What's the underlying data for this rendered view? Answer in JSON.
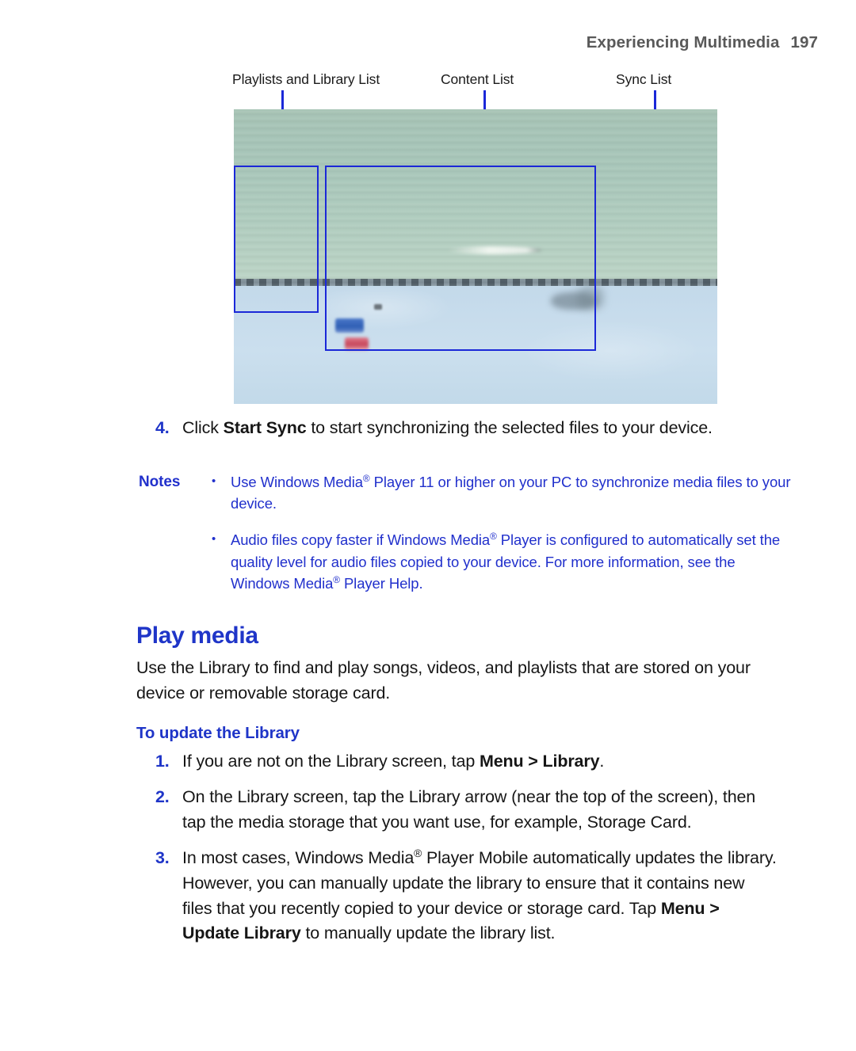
{
  "header": {
    "title": "Experiencing Multimedia",
    "page_number": "197"
  },
  "figure": {
    "callouts": [
      {
        "label": "Playlists and Library List"
      },
      {
        "label": "Content List"
      },
      {
        "label": "Sync List"
      }
    ],
    "annotation_color": "#1b28d8",
    "image_description": "Blurred device screenshot showing Windows Media Player sync view"
  },
  "step4": {
    "number": "4.",
    "text_before": "Click ",
    "bold": "Start Sync",
    "text_after": " to start synchronizing the selected files to your device."
  },
  "notes": {
    "label": "Notes",
    "bullet": "•",
    "items": [
      {
        "part1": "Use Windows Media",
        "reg": "®",
        "part2": " Player 11 or higher on your PC to synchronize media files to your device."
      },
      {
        "part1": "Audio files copy faster if Windows Media",
        "reg": "®",
        "part2": " Player is configured to automatically set the quality level for audio files copied to your device. For more information, see the Windows Media",
        "reg2": "®",
        "part3": " Player Help."
      }
    ]
  },
  "play_media": {
    "heading": "Play media",
    "paragraph": "Use the Library to find and play songs, videos, and playlists that are stored on your device or removable storage card.",
    "subheading": "To update the Library",
    "steps": [
      {
        "number": "1.",
        "text_before": "If you are not on the Library screen, tap ",
        "bold": "Menu > Library",
        "text_after": "."
      },
      {
        "number": "2.",
        "text_before": "On the Library screen, tap the Library arrow (near the top of the screen), then tap the media storage that you want use, for example, Storage Card.",
        "bold": "",
        "text_after": ""
      },
      {
        "number": "3.",
        "text_before": "In most cases, Windows Media",
        "reg": "®",
        "text_mid": " Player Mobile automatically updates the library. However, you can manually update the library to ensure that it contains new files that you recently copied to your device or storage card. Tap ",
        "bold": "Menu > Update Library",
        "text_after": " to manually update the library list."
      }
    ]
  }
}
